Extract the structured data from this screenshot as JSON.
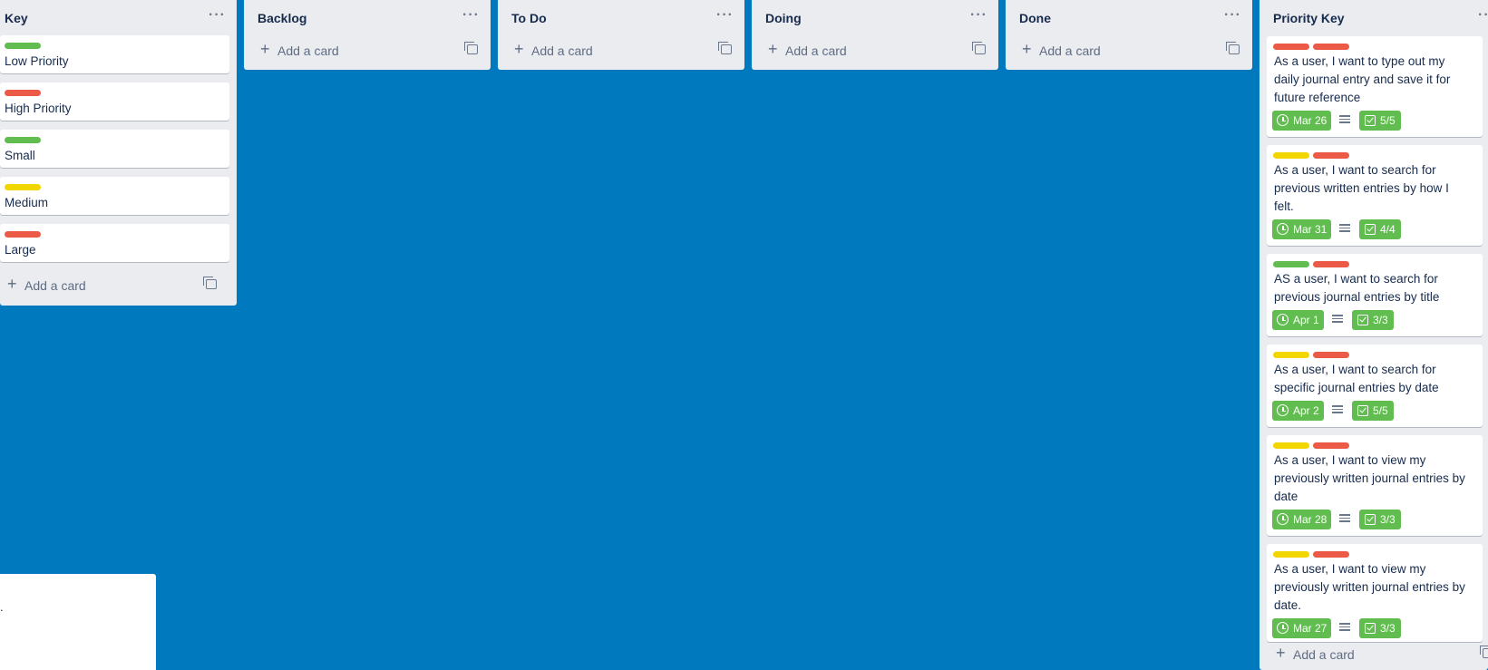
{
  "colors": {
    "board_background": "#0079bf",
    "label_green": "#61bd4f",
    "label_red": "#eb5a46",
    "label_yellow": "#f2d600",
    "badge_green": "#61bd4f"
  },
  "list_menu_glyph": "···",
  "add_card_label": "Add a card",
  "lists": [
    {
      "title": "Key",
      "cards": [
        {
          "label_color": "green",
          "text": "Low Priority"
        },
        {
          "label_color": "red",
          "text": "High Priority"
        },
        {
          "label_color": "green",
          "text": "Small"
        },
        {
          "label_color": "yellow",
          "text": "Medium"
        },
        {
          "label_color": "red",
          "text": "Large"
        }
      ]
    },
    {
      "title": "Backlog",
      "cards": []
    },
    {
      "title": "To Do",
      "cards": []
    },
    {
      "title": "Doing",
      "cards": []
    },
    {
      "title": "Done",
      "cards": []
    },
    {
      "title": "Priority Key",
      "cards": [
        {
          "labels": [
            "red",
            "red"
          ],
          "text_lines": [
            "As a user, I want to type out my",
            "daily journal entry and save it for",
            "future reference"
          ],
          "due": "Mar 26",
          "has_description": true,
          "checklist": "5/5"
        },
        {
          "labels": [
            "yellow",
            "red"
          ],
          "text_lines": [
            "As a user, I want to search for",
            "previous written entries by how I",
            "felt."
          ],
          "due": "Mar 31",
          "has_description": true,
          "checklist": "4/4"
        },
        {
          "labels": [
            "green",
            "red"
          ],
          "text_lines": [
            "AS a user, I want to search for",
            "previous journal entries by title"
          ],
          "due": "Apr 1",
          "has_description": true,
          "checklist": "3/3"
        },
        {
          "labels": [
            "yellow",
            "red"
          ],
          "text_lines": [
            "As a user, I want to search for",
            "specific journal entries by date"
          ],
          "due": "Apr 2",
          "has_description": true,
          "checklist": "5/5"
        },
        {
          "labels": [
            "yellow",
            "red"
          ],
          "text_lines": [
            "As a user, I want to view my",
            "previously written journal entries by",
            "date"
          ],
          "due": "Mar 28",
          "has_description": true,
          "checklist": "3/3"
        },
        {
          "labels": [
            "yellow",
            "red"
          ],
          "text_lines": [
            "As a user, I want to view my",
            "previously written journal entries by",
            "date."
          ],
          "due": "Mar 27",
          "has_description": true,
          "checklist": "3/3"
        }
      ]
    }
  ],
  "popup": {
    "text": "."
  }
}
